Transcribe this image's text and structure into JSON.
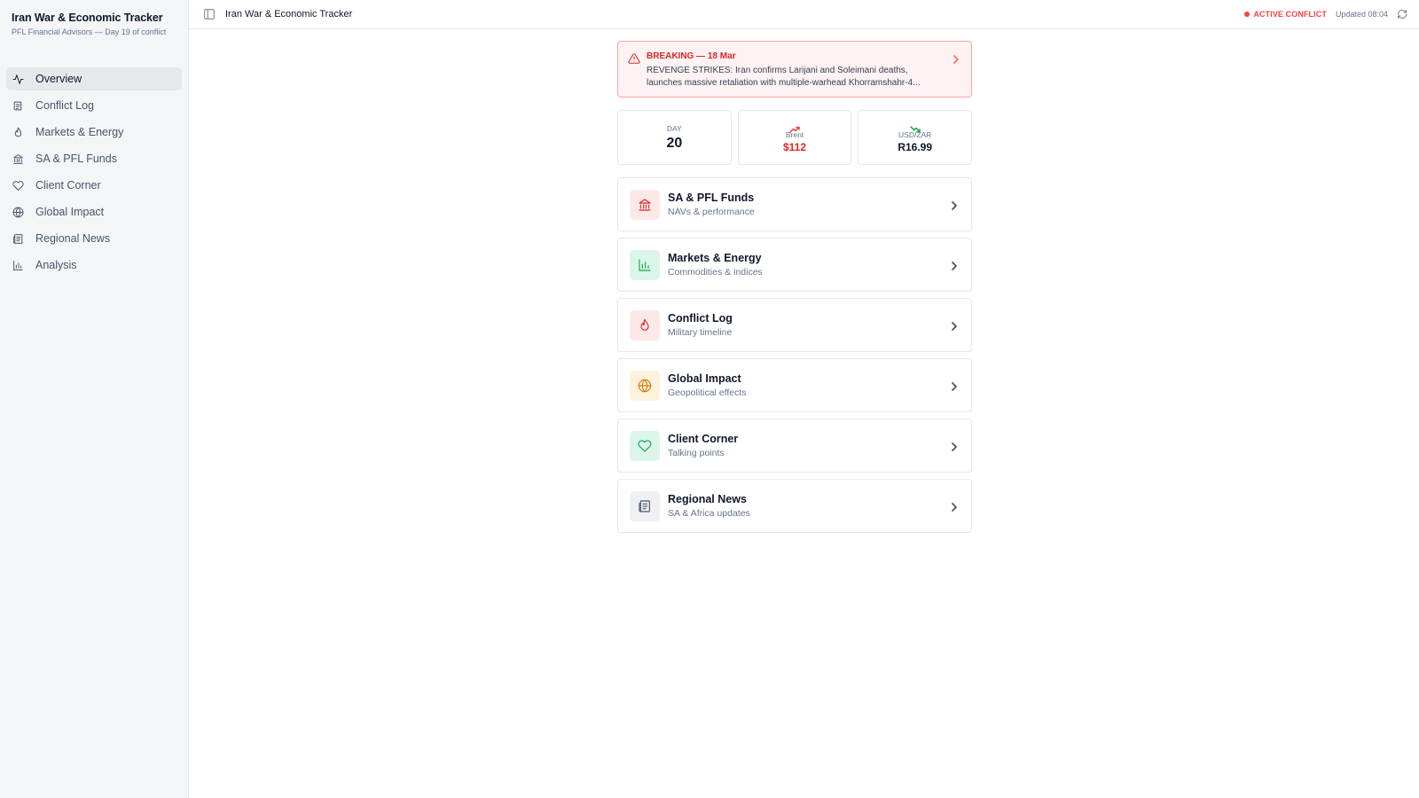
{
  "sidebar": {
    "title": "Iran War & Economic Tracker",
    "subtitle": "PFL Financial Advisors — Day 19 of conflict",
    "items": [
      {
        "label": "Overview",
        "icon": "activity-icon"
      },
      {
        "label": "Conflict Log",
        "icon": "log-icon"
      },
      {
        "label": "Markets & Energy",
        "icon": "flame-icon"
      },
      {
        "label": "SA & PFL Funds",
        "icon": "bank-icon"
      },
      {
        "label": "Client Corner",
        "icon": "heart-icon"
      },
      {
        "label": "Global Impact",
        "icon": "globe-icon"
      },
      {
        "label": "Regional News",
        "icon": "newspaper-icon"
      },
      {
        "label": "Analysis",
        "icon": "bar-chart-icon"
      }
    ]
  },
  "topbar": {
    "title": "Iran War & Economic Tracker",
    "status": "ACTIVE CONFLICT",
    "updated": "Updated 08:04"
  },
  "alert": {
    "title": "BREAKING — 18 Mar",
    "text": "REVENGE STRIKES: Iran confirms Larijani and Soleimani deaths, launches massive retaliation with multiple-warhead Khorramshahr-4..."
  },
  "stats": {
    "day": {
      "label": "DAY",
      "value": "20"
    },
    "brent": {
      "label": "Brent",
      "value": "$112",
      "color": "#dc2626",
      "trend": "up"
    },
    "usdzar": {
      "label": "USD/ZAR",
      "value": "R16.99",
      "color": "#0f172a",
      "trend": "down"
    }
  },
  "cards": [
    {
      "title": "SA & PFL Funds",
      "subtitle": "NAVs & performance",
      "icon": "bank-icon",
      "bg": "#fde8e8",
      "fg": "#dc2626"
    },
    {
      "title": "Markets & Energy",
      "subtitle": "Commodities & indices",
      "icon": "bar-chart-icon",
      "bg": "#dcf5ea",
      "fg": "#16a34a"
    },
    {
      "title": "Conflict Log",
      "subtitle": "Military timeline",
      "icon": "flame-icon",
      "bg": "#fde8e8",
      "fg": "#dc2626"
    },
    {
      "title": "Global Impact",
      "subtitle": "Geopolitical effects",
      "icon": "globe-icon",
      "bg": "#fdf2dc",
      "fg": "#d97706"
    },
    {
      "title": "Client Corner",
      "subtitle": "Talking points",
      "icon": "heart-icon",
      "bg": "#dcf5ea",
      "fg": "#16a34a"
    },
    {
      "title": "Regional News",
      "subtitle": "SA & Africa updates",
      "icon": "newspaper-icon",
      "bg": "#eef0f3",
      "fg": "#475569"
    }
  ]
}
